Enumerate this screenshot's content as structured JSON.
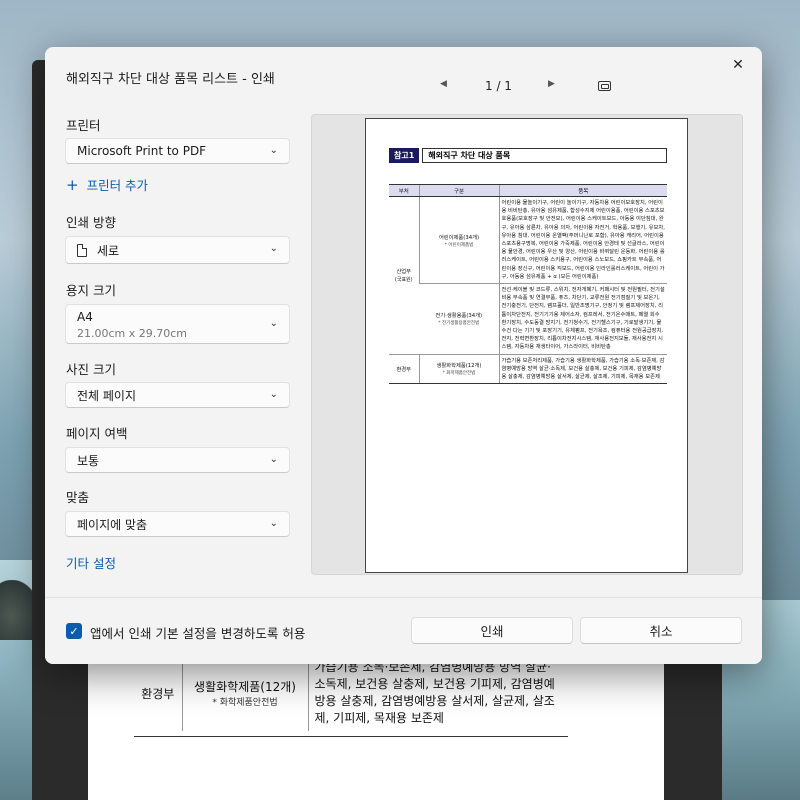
{
  "dialog": {
    "title": "해외직구 차단 대상 품목 리스트 - 인쇄",
    "close_icon": "✕"
  },
  "pager": {
    "prev": "◀",
    "text": "1 / 1",
    "next": "▶"
  },
  "settings": {
    "printer_label": "프린터",
    "printer_value": "Microsoft Print to PDF",
    "add_printer": "프린터 추가",
    "orientation_label": "인쇄 방향",
    "orientation_value": "세로",
    "paper_size_label": "용지 크기",
    "paper_size_value": "A4",
    "paper_size_sub": "21.00cm x 29.70cm",
    "photo_size_label": "사진 크기",
    "photo_size_value": "전체 페이지",
    "margins_label": "페이지 여백",
    "margins_value": "보통",
    "fit_label": "맞춤",
    "fit_value": "페이지에 맞춤",
    "more_settings": "기타 설정",
    "chevron": "⌄"
  },
  "preview": {
    "badge": "참고1",
    "title": "해외직구 차단 대상 품목",
    "headers": [
      "부처",
      "구분",
      "품목"
    ],
    "groups": [
      {
        "ministry": "산업부",
        "ministry_sub": "(국표원)",
        "rows": [
          {
            "category": "어린이제품(34개)",
            "category_sub": "* 어린이제품법",
            "items": "어린이용 물놀이기구, 어린이 놀이기구, 자동차용 어린이보호장치, 어린이용 비비탄총, 유아용 섬유제품, 합성수지제 어린이용품, 어린이용 스포츠보호용품(보호장구 및 안전모), 어린이용 스케이트보드, 아동용 이단침대, 완구, 유아용 삼륜차, 유아용 의자, 어린이용 자전거, 학용품, 보행기, 유모차, 유아용 침대, 어린이용 온열팩(주머니난로 포함), 유아용 캐리어, 어린이용 스포츠용구명복, 어린이용 가죽제품, 어린이용 안경테 및 선글라스, 어린이용 물안경, 어린이용 우산 및 양산, 어린이용 바퀴달린 운동화, 어린이용 롤러스케이트, 어린이용 스키용구, 어린이용 스노보드, 쇼핑카트 부속품, 어린이용 장신구, 어린이용 킥보드, 어린이용 인라인롤러스케이트, 어린이 가구, 아동용 섬유제품 + α (모든 어린이제품)"
          },
          {
            "category": "전기·생활용품(34개)",
            "category_sub": "* 전기생활용품안전법",
            "items": "전선·케이블 및 코드류, 스위치, 전자개폐기, 커패시터 및 전원필터, 전기설비용 부속품 및 연결부품, 퓨즈, 차단기, 교류전원 전기점질기 및 보온기, 전기충전기, 단전지, 램프홀더, 일반조명기구, 안정기 및 램프제어장치, 리튬이차단전지, 전기기기용 제어소자, 컴프레서, 전기온수매트, 페열 회수 환기장치, 수도동결 방지기, 전기청수기, 전기헬스기구, 기로발생기기, 물수건 다는 기기 및 포장기기, 유체펌프, 전기욕조, 컴퓨터용 전원공급장치, 전지, 전력변환장치, 리튬이차전지시스템, 재사용전지모듈, 재사용전지 시스템, 자동차용 재생타이어, 가스라이터, 비비탄총"
          }
        ]
      },
      {
        "ministry": "환경부",
        "ministry_sub": "",
        "rows": [
          {
            "category": "생활화학제품(12개)",
            "category_sub": "* 화학제품안전법",
            "items": "가습기용 보존처리제품, 가습기용 생활화학제품, 가습기용 소독·보존제, 감염병예방용 방역 살균·소독제, 보건용 살충제, 보건용 기피제, 감염병예방용 살충제, 감염병예방용 살서제, 살균제, 살조제, 기피제, 목재용 보존제"
          }
        ]
      }
    ]
  },
  "background_doc": {
    "ministry": "환경부",
    "category": "생활화학제품(12개)",
    "category_sub": "* 화학제품안전법",
    "items": "가습기용 소독·보존제, 감염병예방용 방역 살균·소독제, 보건용 살충제, 보건용 기피제, 감염병예방용 살충제, 감염병예방용 살서제, 살균제, 살조제, 기피제, 목재용 보존제"
  },
  "footer": {
    "checkbox_label": "앱에서 인쇄 기본 설정을 변경하도록 허용",
    "checkbox_mark": "✓",
    "print_button": "인쇄",
    "cancel_button": "취소"
  },
  "colors": {
    "accent": "#0b5cad",
    "badge": "#1a1a5c",
    "header_fill": "#dcdcf0"
  }
}
